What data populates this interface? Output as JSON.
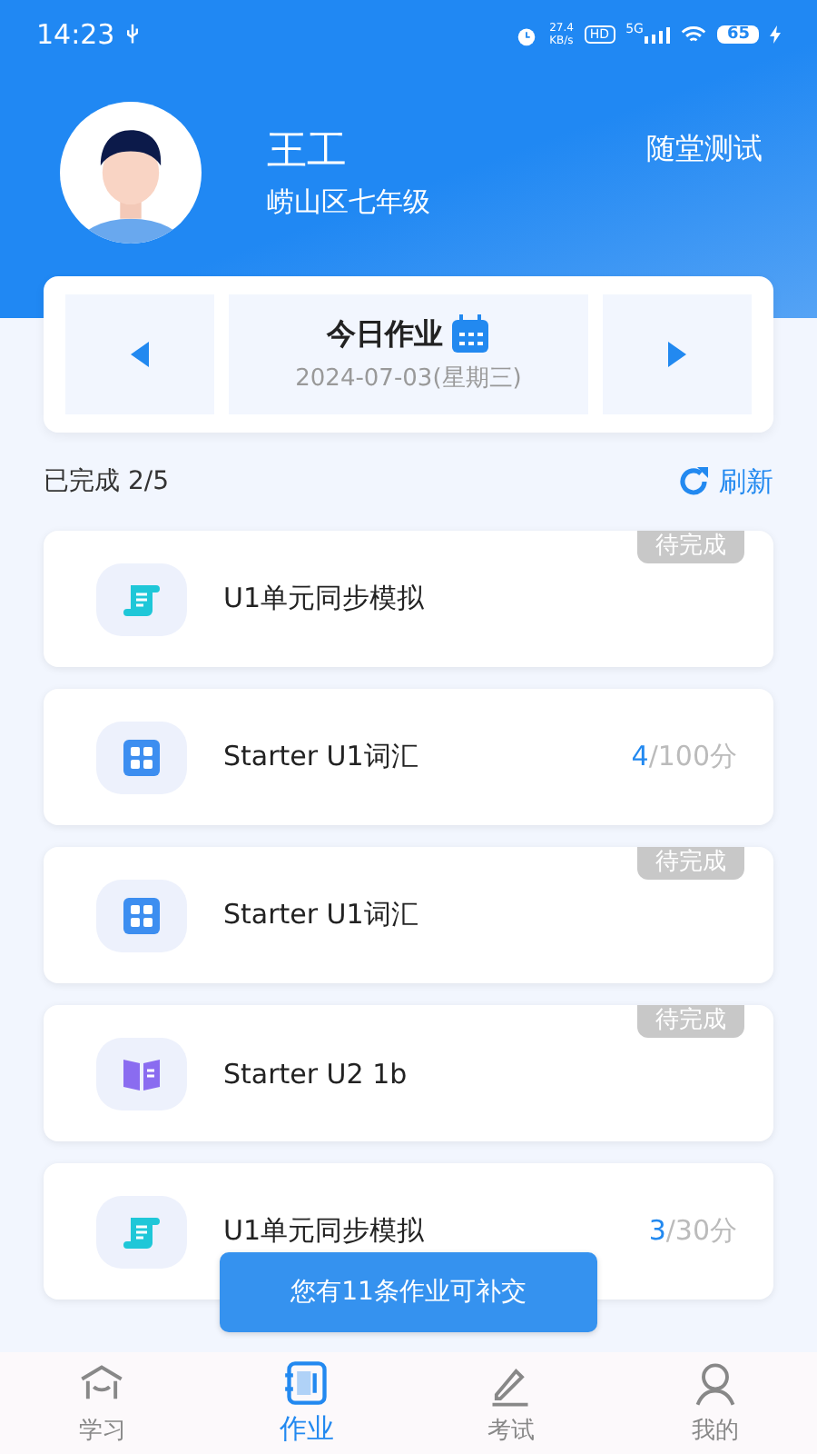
{
  "status_bar": {
    "time": "14:23",
    "speed": "27.4",
    "speed_unit": "KB/s",
    "hd": "HD",
    "network": "5G",
    "battery": "65"
  },
  "profile": {
    "name": "王工",
    "school": "崂山区七年级",
    "action": "随堂测试"
  },
  "date_card": {
    "title": "今日作业",
    "date": "2024-07-03(星期三)"
  },
  "progress": {
    "label": "已完成 2/5",
    "refresh": "刷新"
  },
  "homework": [
    {
      "kind": "scroll",
      "title": "U1单元同步模拟",
      "badge": "待完成"
    },
    {
      "kind": "abcd",
      "title": "Starter U1词汇",
      "score": "4",
      "total": "/100分"
    },
    {
      "kind": "abcd",
      "title": "Starter U1词汇",
      "badge": "待完成"
    },
    {
      "kind": "book",
      "title": "Starter U2 1b",
      "badge": "待完成"
    },
    {
      "kind": "scroll",
      "title": "U1单元同步模拟",
      "score": "3",
      "total": "/30分"
    }
  ],
  "toast": "您有11条作业可补交",
  "tabs": [
    {
      "kind": "study",
      "label": "学习",
      "selected": false
    },
    {
      "kind": "homework",
      "label": "作业",
      "selected": true
    },
    {
      "kind": "exam",
      "label": "考试",
      "selected": false
    },
    {
      "kind": "me",
      "label": "我的",
      "selected": false
    }
  ]
}
